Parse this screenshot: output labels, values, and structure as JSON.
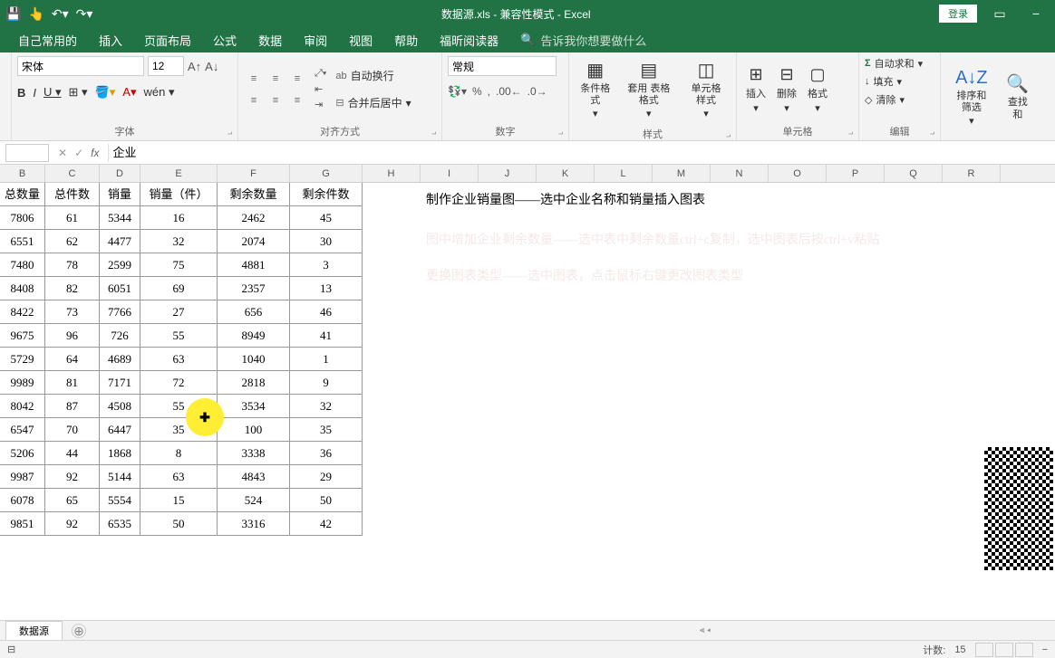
{
  "titlebar": {
    "title": "数据源.xls - 兼容性模式 - Excel",
    "login": "登录"
  },
  "tabs": {
    "items": [
      "自己常用的",
      "插入",
      "页面布局",
      "公式",
      "数据",
      "审阅",
      "视图",
      "帮助",
      "福昕阅读器"
    ],
    "tell_me": "告诉我你想要做什么"
  },
  "ribbon": {
    "font": {
      "label": "字体",
      "name": "宋体",
      "size": "12"
    },
    "align": {
      "label": "对齐方式",
      "wrap": "自动换行",
      "merge": "合并后居中"
    },
    "number": {
      "label": "数字",
      "format": "常规"
    },
    "styles": {
      "label": "样式",
      "cond": "条件格式",
      "table": "套用\n表格格式",
      "cell": "单元格样式"
    },
    "cells": {
      "label": "单元格",
      "insert": "插入",
      "delete": "删除",
      "format": "格式"
    },
    "edit": {
      "label": "编辑",
      "sum": "自动求和",
      "fill": "填充",
      "clear": "清除"
    },
    "sort": {
      "sort": "排序和筛选",
      "find": "查找和"
    }
  },
  "formula_bar": {
    "value": "企业"
  },
  "columns": [
    "B",
    "C",
    "D",
    "E",
    "F",
    "G",
    "H",
    "I",
    "J",
    "K",
    "L",
    "M",
    "N",
    "O",
    "P",
    "Q",
    "R"
  ],
  "headers": [
    "总数量",
    "总件数",
    "销量",
    "销量（件）",
    "剩余数量",
    "剩余件数"
  ],
  "rows": [
    [
      7806,
      61,
      5344,
      16,
      2462,
      45
    ],
    [
      6551,
      62,
      4477,
      32,
      2074,
      30
    ],
    [
      7480,
      78,
      2599,
      75,
      4881,
      3
    ],
    [
      8408,
      82,
      6051,
      69,
      2357,
      13
    ],
    [
      8422,
      73,
      7766,
      27,
      656,
      46
    ],
    [
      9675,
      96,
      726,
      55,
      8949,
      41
    ],
    [
      5729,
      64,
      4689,
      63,
      1040,
      1
    ],
    [
      9989,
      81,
      7171,
      72,
      2818,
      9
    ],
    [
      8042,
      87,
      4508,
      55,
      3534,
      32
    ],
    [
      6547,
      70,
      6447,
      35,
      100,
      35
    ],
    [
      5206,
      44,
      1868,
      8,
      3338,
      36
    ],
    [
      9987,
      92,
      5144,
      63,
      4843,
      29
    ],
    [
      6078,
      65,
      5554,
      15,
      524,
      50
    ],
    [
      9851,
      92,
      6535,
      50,
      3316,
      42
    ]
  ],
  "notes": {
    "main": "制作企业销量图——选中企业名称和销量插入图表",
    "faded1": "图中增加企业剩余数量——选中表中剩余数量ctrl+c复制，选中图表后按ctrl+v粘贴",
    "faded2": "更换图表类型——选中图表，点击鼠标右键更改图表类型"
  },
  "sheet": {
    "name": "数据源"
  },
  "status": {
    "count_label": "计数:",
    "count": "15"
  }
}
